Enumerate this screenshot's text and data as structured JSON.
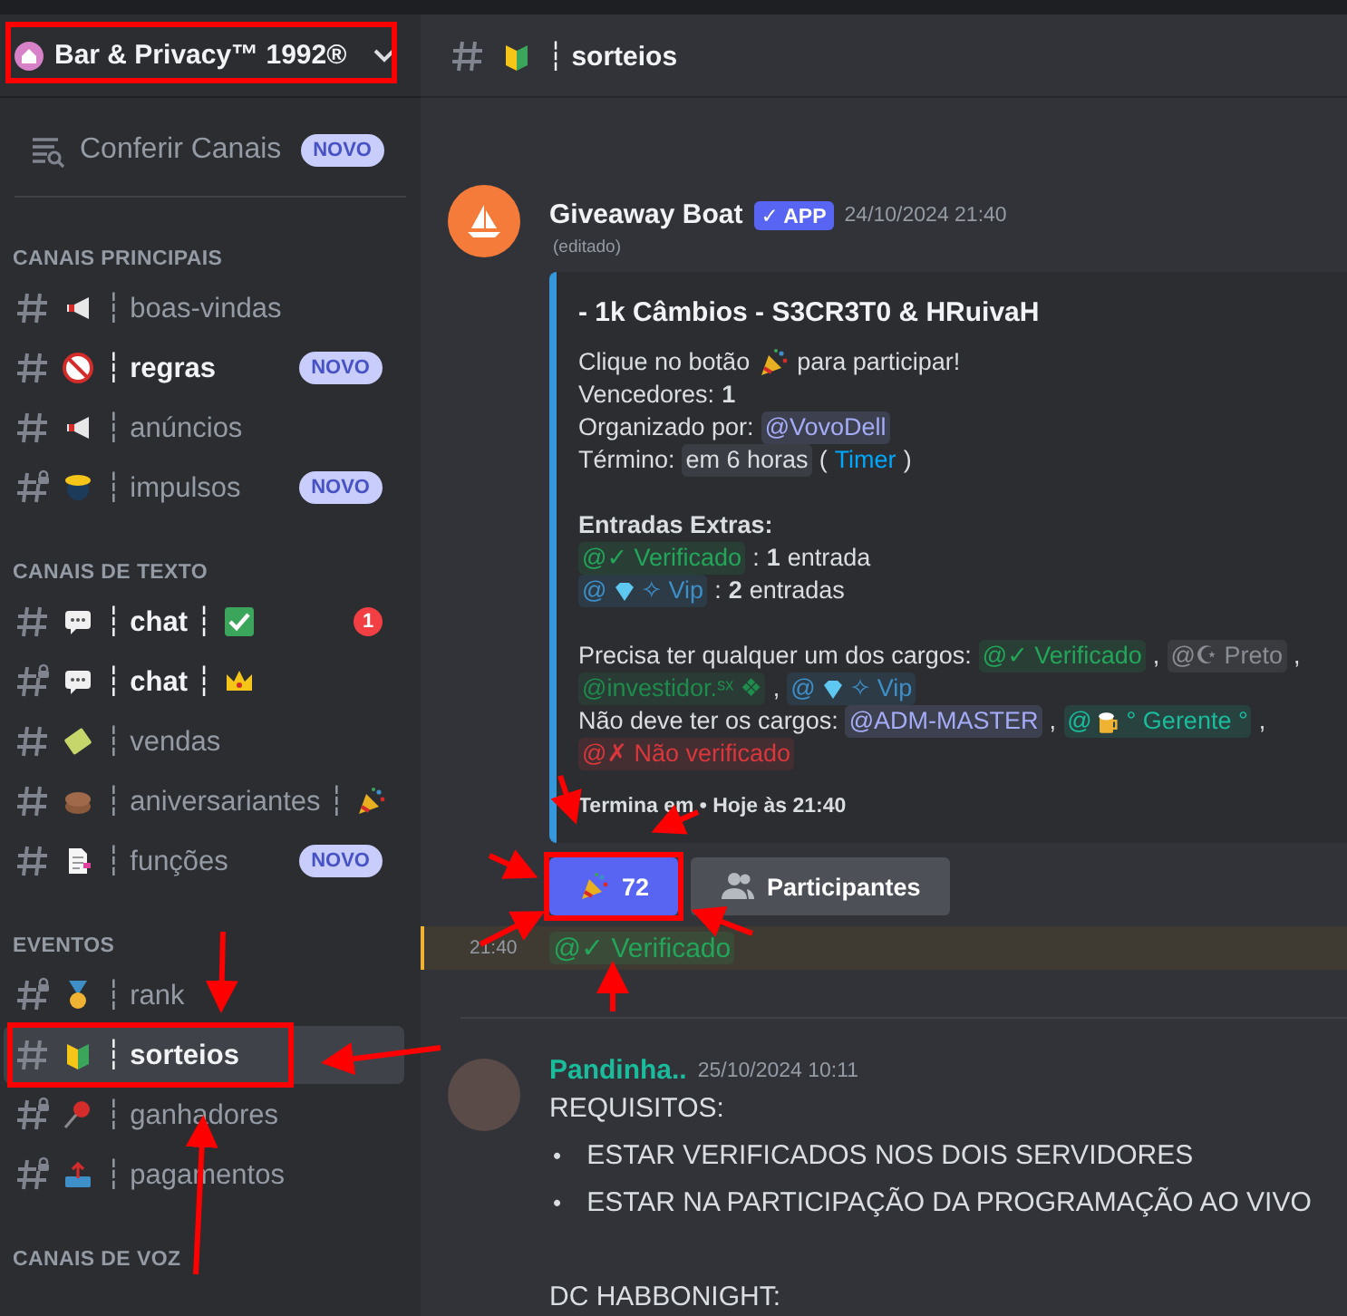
{
  "server": {
    "name": "Bar & Privacy™ 1992®",
    "highlighted": true
  },
  "browse": {
    "label": "Conferir Canais",
    "badge": "NOVO"
  },
  "categories": [
    {
      "name": "CANAIS PRINCIPAIS",
      "channels": [
        {
          "kind": "megaphone",
          "name": "┆ boas-vindas",
          "locked": false,
          "unread": false,
          "selected": false,
          "highlighted": false
        },
        {
          "kind": "nosmoking",
          "name": "┆ regras",
          "locked": false,
          "unread": true,
          "selected": false,
          "highlighted": false,
          "badge": "NOVO"
        },
        {
          "kind": "megaphone",
          "name": "┆ anúncios",
          "locked": false,
          "unread": false,
          "selected": false,
          "highlighted": false
        },
        {
          "kind": "bee",
          "name": "┆ impulsos",
          "locked": true,
          "unread": false,
          "selected": false,
          "highlighted": false,
          "badge": "NOVO"
        }
      ]
    },
    {
      "name": "CANAIS DE TEXTO",
      "channels": [
        {
          "kind": "speech",
          "name": "┆ chat ┆",
          "trailing": {
            "kind": "check"
          },
          "locked": false,
          "unread": true,
          "selected": false,
          "highlighted": false,
          "count": "1"
        },
        {
          "kind": "speech",
          "name": "┆ chat ┆",
          "trailing": {
            "kind": "crown"
          },
          "locked": true,
          "unread": true,
          "selected": false,
          "highlighted": false
        },
        {
          "kind": "ticket",
          "name": "┆ vendas",
          "locked": false,
          "unread": false,
          "selected": false,
          "highlighted": false
        },
        {
          "kind": "cake",
          "name": "┆ aniversariantes ┆",
          "trailing": {
            "kind": "party"
          },
          "locked": false,
          "unread": false,
          "selected": false,
          "highlighted": false
        },
        {
          "kind": "document",
          "name": "┆ funções",
          "locked": false,
          "unread": false,
          "selected": false,
          "highlighted": false,
          "badge": "NOVO"
        }
      ]
    },
    {
      "name": "EVENTOS",
      "channels": [
        {
          "kind": "medal",
          "name": "┆ rank",
          "locked": true,
          "unread": false,
          "selected": false,
          "highlighted": false
        },
        {
          "kind": "beginner",
          "name": "┆ sorteios",
          "locked": false,
          "unread": true,
          "selected": true,
          "highlighted": true
        },
        {
          "kind": "pin",
          "name": "┆ ganhadores",
          "locked": true,
          "unread": false,
          "selected": false,
          "highlighted": false
        },
        {
          "kind": "upload",
          "name": "┆ pagamentos",
          "locked": true,
          "unread": false,
          "selected": false,
          "highlighted": false
        }
      ]
    },
    {
      "name": "CANAIS DE VOZ"
    }
  ],
  "header": {
    "icon": {
      "kind": "beginner"
    },
    "title": "┆ sorteios"
  },
  "messages": [
    {
      "kind": "bot",
      "author": "Giveaway Boat",
      "tag": "✓ APP",
      "time": "24/10/2024 21:40",
      "edited": "(editado)",
      "embed": {
        "title": "- 1k Câmbios - S3CR3T0 & HRuivaH",
        "footer": "Termina em • Hoje às 21:40",
        "blocks": [
          [
            [
              {
                "kind": "text",
                "text": "Clique no botão"
              },
              {
                "kind": "party"
              },
              {
                "kind": "text",
                "text": "para participar!"
              }
            ],
            [
              {
                "kind": "text",
                "text": "Vencedores:"
              },
              {
                "kind": "bold",
                "text": "1"
              }
            ],
            [
              {
                "kind": "text",
                "text": "Organizado por:"
              },
              {
                "kind": "mention",
                "text": "@VovoDell",
                "color": "#a5acf7"
              }
            ],
            [
              {
                "kind": "text",
                "text": "Término:"
              },
              {
                "kind": "time",
                "text": "em 6 horas"
              },
              {
                "kind": "text",
                "text": "("
              },
              {
                "kind": "link",
                "text": "Timer"
              },
              {
                "kind": "text",
                "text": ")"
              }
            ]
          ],
          [
            [
              {
                "kind": "bold",
                "text": "Entradas Extras:"
              }
            ],
            [
              {
                "kind": "mention",
                "text": "@✓ Verificado",
                "color": "#23a55a"
              },
              {
                "kind": "text",
                "text": ":"
              },
              {
                "kind": "bold",
                "text": "1"
              },
              {
                "kind": "text",
                "text": "entrada"
              }
            ],
            [
              {
                "kind": "mention",
                "text": "@",
                "icon": {
                  "kind": "gem"
                },
                "rest": "✧ Vip",
                "color": "#3e8fc8"
              },
              {
                "kind": "text",
                "text": ":"
              },
              {
                "kind": "bold",
                "text": "2"
              },
              {
                "kind": "text",
                "text": "entradas"
              }
            ]
          ],
          [
            [
              {
                "kind": "text",
                "text": "Precisa ter qualquer um dos cargos:"
              },
              {
                "kind": "mention",
                "text": "@✓ Verificado",
                "color": "#23a55a"
              },
              {
                "kind": "text",
                "text": ","
              },
              {
                "kind": "mention",
                "text": "@☪ Preto",
                "color": "#8a8d93"
              },
              {
                "kind": "text",
                "text": ","
              },
              {
                "kind": "mention",
                "text": "@investidor.ˢˣ ❖",
                "color": "#1f8b4c"
              },
              {
                "kind": "text",
                "text": ","
              },
              {
                "kind": "mention",
                "text": "@",
                "icon": {
                  "kind": "gem"
                },
                "rest": "✧ Vip",
                "color": "#3e8fc8"
              }
            ],
            [
              {
                "kind": "text",
                "text": "Não deve ter os cargos:"
              },
              {
                "kind": "mention",
                "text": "@ADM-MASTER",
                "color": "#a5acf7"
              },
              {
                "kind": "text",
                "text": ","
              },
              {
                "kind": "mention",
                "text": "@",
                "icon": {
                  "kind": "beer"
                },
                "rest": "° Gerente °",
                "color": "#1abc9c"
              },
              {
                "kind": "text",
                "text": ","
              },
              {
                "kind": "mention",
                "text": "@✗ Não verificado",
                "color": "#da373c"
              }
            ]
          ]
        ]
      },
      "buttons": [
        {
          "kind": "primary",
          "icon": {
            "kind": "party"
          },
          "label": "72",
          "highlighted": true
        },
        {
          "kind": "secondary",
          "label": "Participantes",
          "highlighted": false
        }
      ]
    },
    {
      "kind": "followup",
      "time": "21:40",
      "highlighted": true,
      "mention": {
        "text": "@✓ Verificado",
        "color": "#23a55a"
      }
    },
    {
      "kind": "user",
      "author": "Pandinha..",
      "color": "#1abc9c",
      "time": "25/10/2024 10:11",
      "lines": [
        "REQUISITOS:"
      ],
      "bullets": [
        {
          "marker": "•",
          "text": "ESTAR VERIFICADOS NOS DOIS SERVIDORES"
        },
        {
          "marker": "•",
          "text": "ESTAR NA PARTICIPAÇÃO DA PROGRAMAÇÃO AO VIVO"
        }
      ],
      "after": [
        "DC HABBONIGHT:"
      ]
    }
  ]
}
